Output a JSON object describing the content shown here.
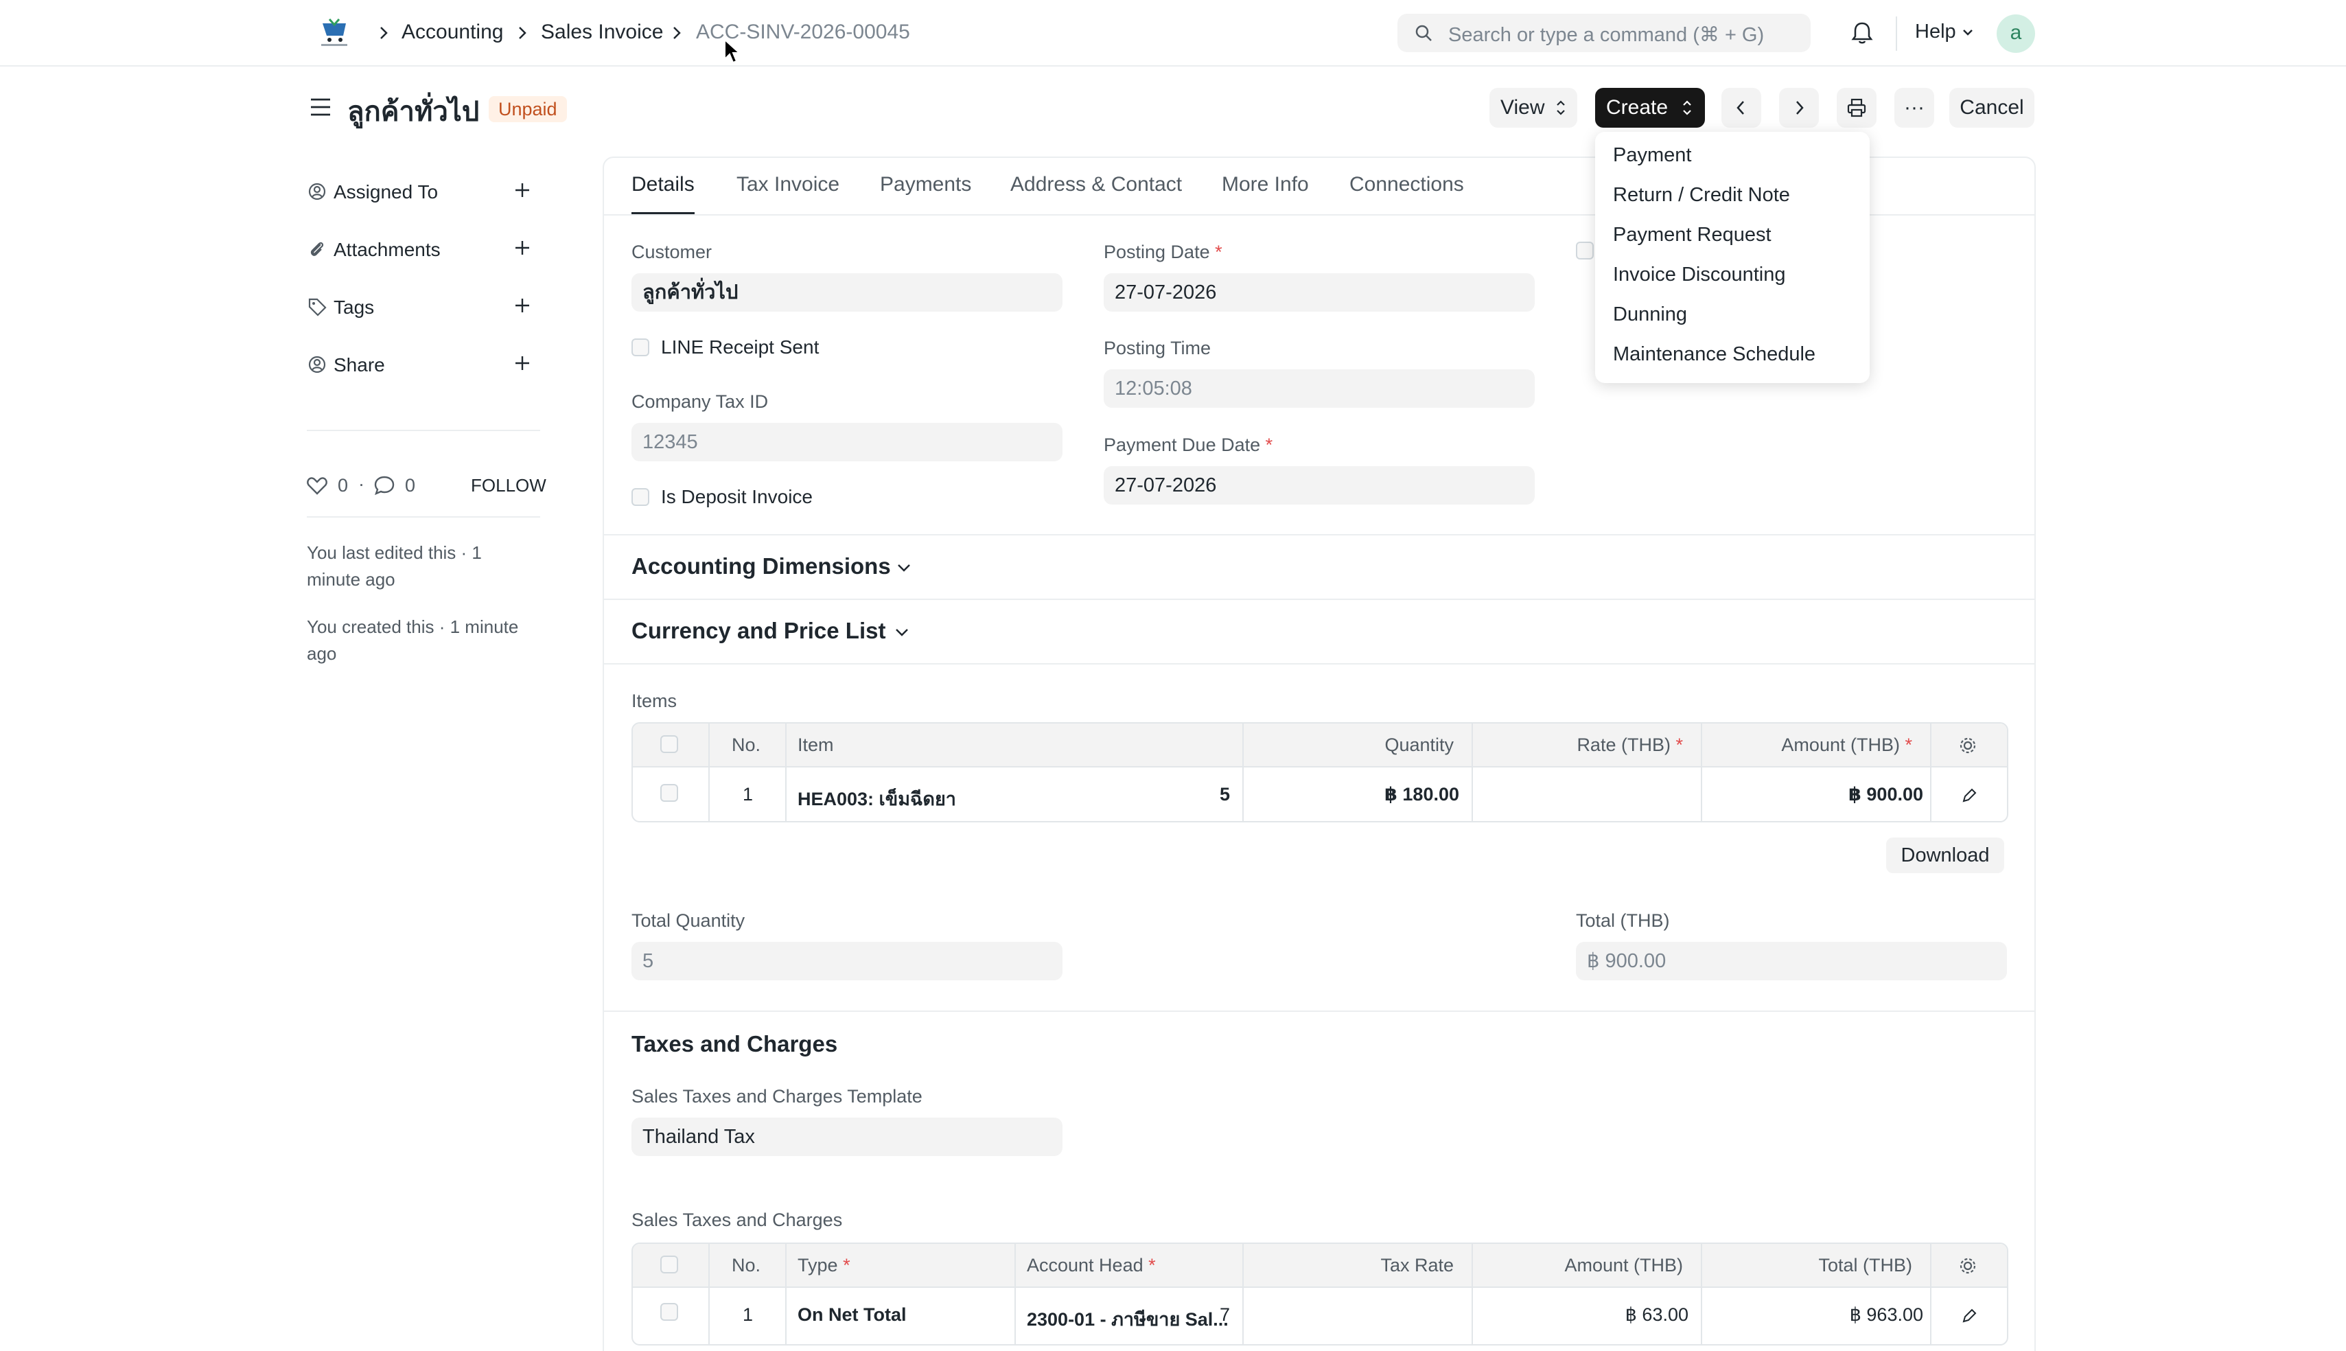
{
  "breadcrumbs": [
    "Accounting",
    "Sales Invoice",
    "ACC-SINV-2026-00045"
  ],
  "search": {
    "placeholder": "Search or type a command (⌘ + G)"
  },
  "navbar": {
    "help_label": "Help",
    "avatar_letter": "a"
  },
  "header": {
    "title": "ลูกค้าทั่วไป",
    "status": "Unpaid",
    "view_label": "View",
    "create_label": "Create",
    "more_label": "···",
    "cancel_label": "Cancel"
  },
  "create_menu": [
    "Payment",
    "Return / Credit Note",
    "Payment Request",
    "Invoice Discounting",
    "Dunning",
    "Maintenance Schedule"
  ],
  "sidebar": {
    "items": [
      {
        "label": "Assigned To",
        "icon": "assign-icon"
      },
      {
        "label": "Attachments",
        "icon": "paperclip-icon"
      },
      {
        "label": "Tags",
        "icon": "tag-icon"
      },
      {
        "label": "Share",
        "icon": "share-icon"
      }
    ],
    "likes": "0",
    "comments": "0",
    "follow_label": "FOLLOW",
    "activity": [
      "You last edited this · 1 minute ago",
      "You created this · 1 minute ago"
    ]
  },
  "tabs": [
    "Details",
    "Tax Invoice",
    "Payments",
    "Address & Contact",
    "More Info",
    "Connections"
  ],
  "details": {
    "customer_label": "Customer",
    "customer_value": "ลูกค้าทั่วไป",
    "line_receipt_label": "LINE Receipt Sent",
    "company_tax_label": "Company Tax ID",
    "company_tax_value": "12345",
    "deposit_label": "Is Deposit Invoice",
    "posting_date_label": "Posting Date",
    "posting_date_value": "27-07-2026",
    "posting_time_label": "Posting Time",
    "posting_time_value": "12:05:08",
    "due_date_label": "Payment Due Date",
    "due_date_value": "27-07-2026"
  },
  "sections": {
    "accounting_dimensions": "Accounting Dimensions",
    "currency_price_list": "Currency and Price List",
    "taxes_charges": "Taxes and Charges"
  },
  "items_table": {
    "label": "Items",
    "columns": [
      "No.",
      "Item",
      "Quantity",
      "Rate (THB)",
      "Amount (THB)"
    ],
    "rows": [
      {
        "no": "1",
        "item": "HEA003: เข็มฉีดยา",
        "qty": "5",
        "rate": "฿ 180.00",
        "amount": "฿ 900.00"
      }
    ],
    "download_label": "Download"
  },
  "totals": {
    "total_qty_label": "Total Quantity",
    "total_qty_value": "5",
    "total_label": "Total (THB)",
    "total_value": "฿ 900.00"
  },
  "taxes": {
    "template_label": "Sales Taxes and Charges Template",
    "template_value": "Thailand Tax",
    "table_label": "Sales Taxes and Charges",
    "columns": [
      "No.",
      "Type",
      "Account Head",
      "Tax Rate",
      "Amount (THB)",
      "Total (THB)"
    ],
    "rows": [
      {
        "no": "1",
        "type": "On Net Total",
        "account": "2300-01 - ภาษีขาย Sal...",
        "rate": "7",
        "amount": "฿ 63.00",
        "total": "฿ 963.00"
      }
    ]
  },
  "colors": {
    "accent": "#171717",
    "unpaid_bg": "#fff1e6",
    "unpaid_text": "#c1501e",
    "required": "#e24c4c"
  }
}
